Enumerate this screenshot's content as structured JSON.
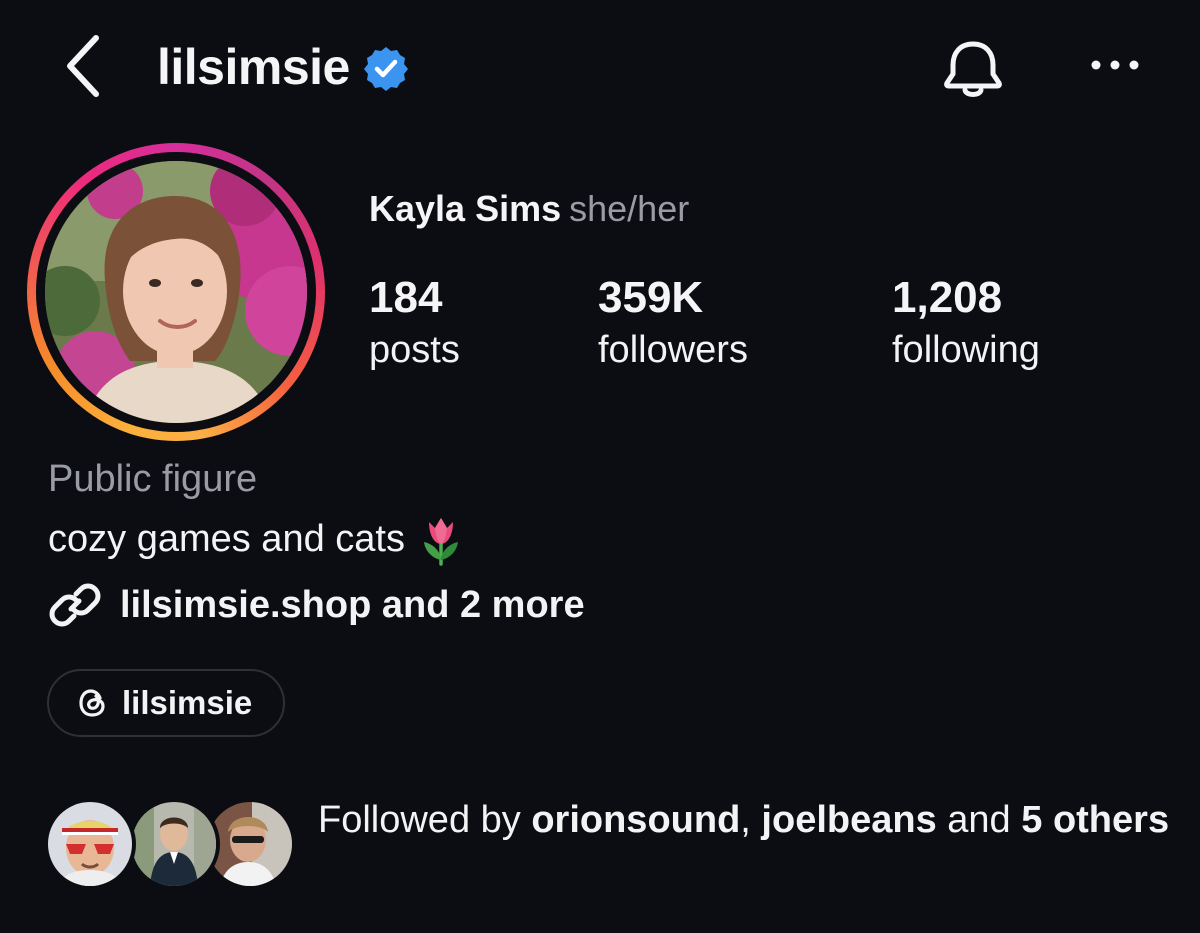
{
  "header": {
    "username": "lilsimsie",
    "verified": true,
    "icons": {
      "back": "chevron-left-icon",
      "verified": "verified-badge-icon",
      "notifications": "bell-icon",
      "more": "more-horizontal-icon"
    }
  },
  "profile": {
    "full_name": "Kayla Sims",
    "pronouns": "she/her",
    "stats": {
      "posts_value": "184",
      "posts_label": "posts",
      "followers_value": "359K",
      "followers_label": "followers",
      "following_value": "1,208",
      "following_label": "following"
    },
    "category": "Public figure",
    "bio": "cozy games and cats",
    "bio_emoji": "tulip-icon",
    "link_text": "lilsimsie.shop and 2 more",
    "threads_handle": "lilsimsie"
  },
  "followed_by": {
    "prefix": "Followed by ",
    "user1": "orionsound",
    "separator": ", ",
    "user2": "joelbeans",
    "middle": " and ",
    "others": "5 others"
  },
  "colors": {
    "background": "#0c0d12",
    "text": "#f2f3f5",
    "secondary_text": "#9a9ca3",
    "verified_blue": "#3b95f0",
    "chip_border": "#2e3036"
  }
}
